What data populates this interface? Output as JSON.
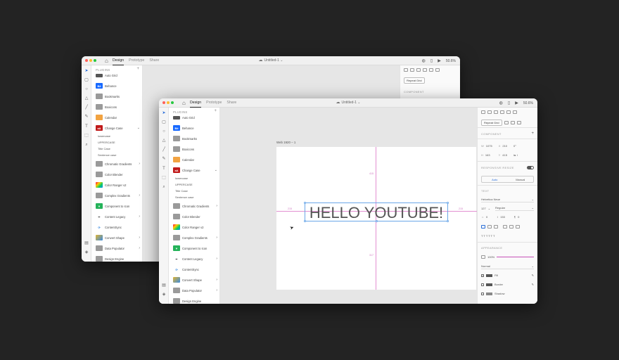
{
  "windows": {
    "tabs": [
      "Design",
      "Prototype",
      "Share"
    ],
    "active_tab": "Design",
    "doc_title": "Untitled-1",
    "zoom": "50.6%"
  },
  "plugins_panel": {
    "heading": "PLUGINS",
    "items": [
      {
        "label": "Auto Grid",
        "icon": "grid-icon",
        "color": "#555555"
      },
      {
        "label": "Behance",
        "icon": "behance-icon",
        "color": "#1769ff",
        "mark": "Bē"
      },
      {
        "label": "Bookmarks",
        "icon": "folder-icon",
        "color": "#9a9a9a"
      },
      {
        "label": "Boxicons",
        "icon": "folder-icon",
        "color": "#9a9a9a"
      },
      {
        "label": "Calendar",
        "icon": "calendar-icon",
        "color": "#f2a341"
      },
      {
        "label": "Change Case",
        "icon": "change-case-icon",
        "color": "#c01a1a",
        "mark": "aA"
      },
      {
        "label": "Chromatic Gradients",
        "icon": "folder-icon",
        "color": "#9a9a9a"
      },
      {
        "label": "Color Blender",
        "icon": "folder-icon",
        "color": "#9a9a9a"
      },
      {
        "label": "Color Ranger v2",
        "icon": "color-ranger-icon",
        "color": "#8a4fd0"
      },
      {
        "label": "Complex Gradients",
        "icon": "folder-icon",
        "color": "#9a9a9a"
      },
      {
        "label": "Component to Icon",
        "icon": "component-icon",
        "color": "#25b35a"
      },
      {
        "label": "Content Legacy",
        "icon": "pen-icon",
        "color": "#444444"
      },
      {
        "label": "ContentSync",
        "icon": "sync-icon",
        "color": "#3a8be0"
      },
      {
        "label": "Convert Shape",
        "icon": "shape-icon",
        "color": "#e0b431"
      },
      {
        "label": "Data Populator",
        "icon": "folder-icon",
        "color": "#9a9a9a"
      },
      {
        "label": "Design Engine",
        "icon": "folder-icon",
        "color": "#9a9a9a"
      }
    ],
    "change_case_options": [
      "lowercase",
      "UPPERCASE",
      "Title Case",
      "Sentence case"
    ]
  },
  "canvas": {
    "artboard_label": "Web 1920 – 1",
    "text": "HELLO YOUTUBE!",
    "guides": {
      "top": "415",
      "left": "215",
      "right": "215",
      "bottom": "317"
    }
  },
  "properties": {
    "repeat_grid": "Repeat Grid",
    "component_heading": "COMPONENT",
    "w_label": "W",
    "w": "1075",
    "x_label": "X",
    "x": "210",
    "rotation": "0°",
    "h_label": "H",
    "h": "163",
    "y_label": "Y",
    "y": "415",
    "responsive_heading": "RESPONSIVE RESIZE",
    "auto": "Auto",
    "manual": "Manual",
    "text_heading": "TEXT",
    "font": "Helvetica Neue",
    "font_size": "127",
    "font_weight": "Regular",
    "char_spacing": "0",
    "line_spacing": "153",
    "para_spacing": "0",
    "appearance_heading": "APPEARANCE",
    "opacity": "100%",
    "blend": "Normal",
    "fill": "Fill",
    "border": "Border",
    "shadow": "Shadow"
  }
}
